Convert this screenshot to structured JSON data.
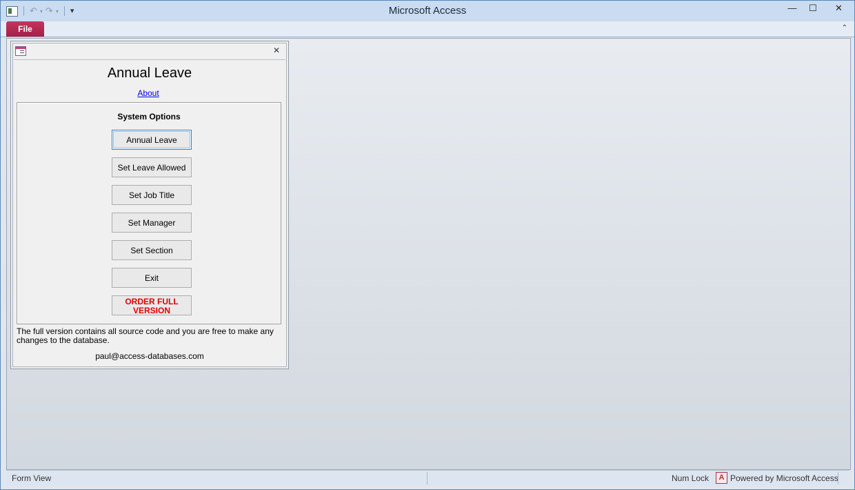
{
  "window": {
    "title": "Microsoft Access"
  },
  "ribbon": {
    "file_tab": "File"
  },
  "form": {
    "title": "Annual Leave",
    "about_link": "About",
    "options_title": "System Options",
    "buttons": [
      "Annual Leave",
      "Set Leave Allowed",
      "Set Job Title",
      "Set Manager",
      "Set Section",
      "Exit"
    ],
    "order_button": {
      "line1": "ORDER FULL",
      "line2": "VERSION"
    },
    "info_text": "The full version contains all source code and you are free to make any changes to the database.",
    "email": "paul@access-databases.com"
  },
  "statusbar": {
    "view": "Form View",
    "num_lock": "Num Lock",
    "powered_by": "Powered by Microsoft Access",
    "logo_letter": "A"
  },
  "icons": {
    "app": "app-icon",
    "undo": "undo-icon",
    "redo": "redo-icon",
    "customize": "customize-qat-icon",
    "minimize": "minimize-icon",
    "maximize": "maximize-icon",
    "close": "close-icon",
    "ribbon_collapse": "chevron-up-icon",
    "form": "form-icon",
    "form_close": "close-icon",
    "access_logo": "access-logo-icon"
  },
  "colors": {
    "file_tab": "#b8284f",
    "order_text": "#e10000",
    "link": "#0000ee"
  }
}
